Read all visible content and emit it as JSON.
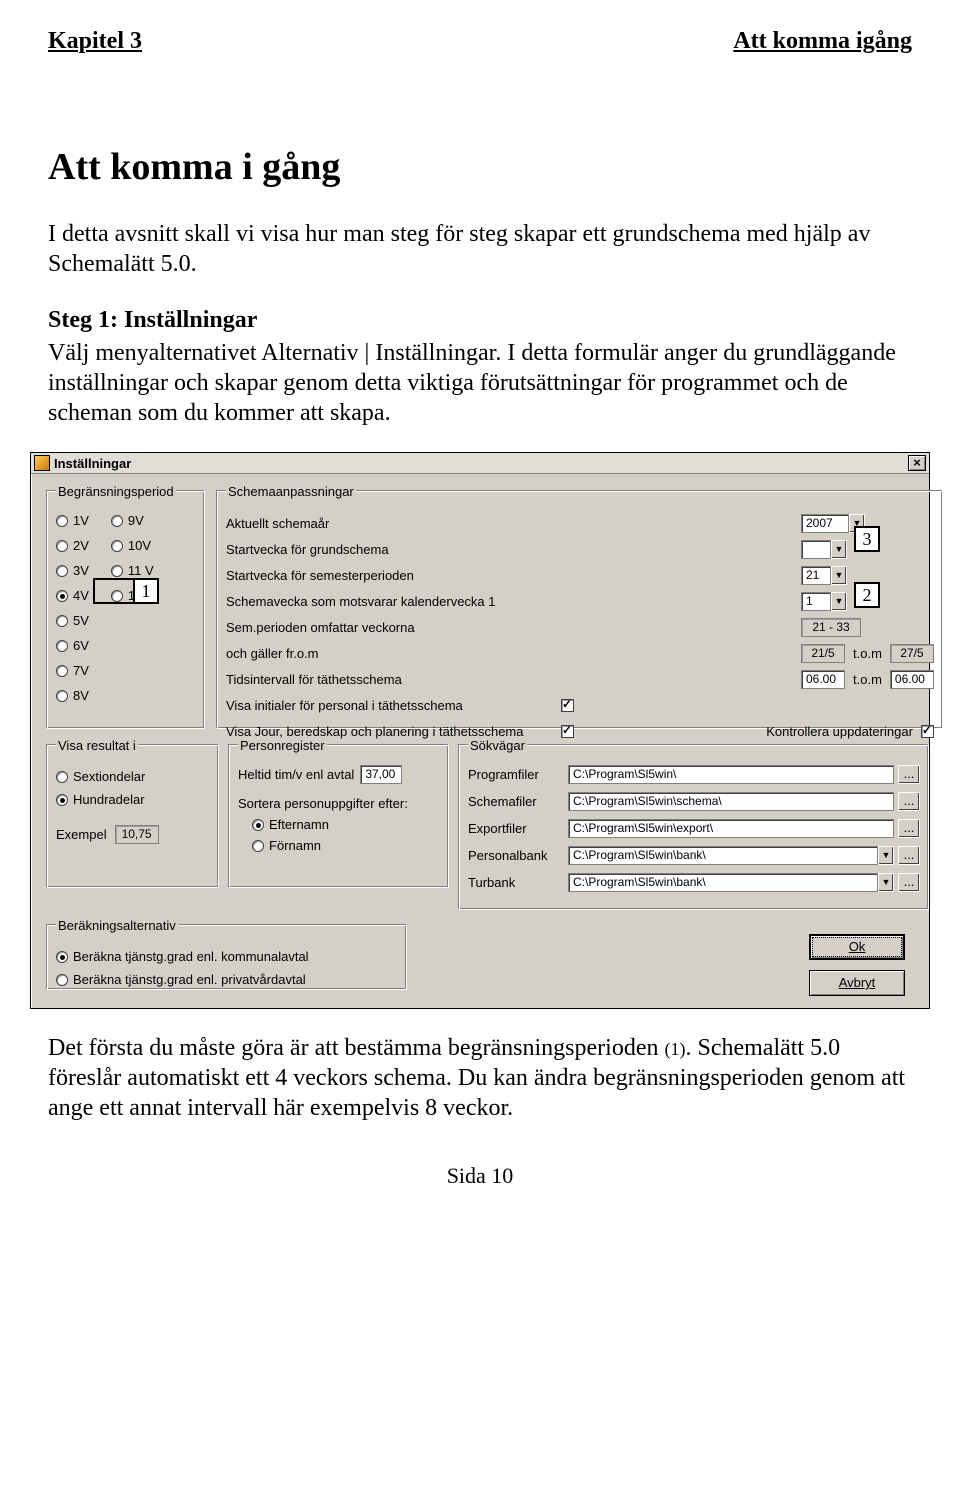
{
  "header": {
    "left": "Kapitel 3",
    "right": "Att komma igång"
  },
  "title": "Att komma i gång",
  "intro": "I detta avsnitt skall vi visa hur man steg för steg skapar ett grundschema med hjälp av Schemalätt 5.0.",
  "step_heading": "Steg 1: Inställningar",
  "step_para": "Välj menyalternativet Alternativ | Inställningar. I detta formulär anger du grundläggande inställningar och skapar genom detta viktiga förutsättningar för programmet och de scheman som du kommer att skapa.",
  "after_para_a": "Det första du måste göra är att bestämma begränsningsperioden ",
  "after_ref": "(1)",
  "after_para_b": ". Schemalätt 5.0 föreslår automatiskt ett 4 veckors schema. Du kan ändra begränsningsperioden genom att ange ett annat intervall här exempelvis 8 veckor.",
  "footer": "Sida 10",
  "callouts": {
    "one": "1",
    "two": "2",
    "three": "3"
  },
  "dlg": {
    "title": "Inställningar",
    "close": "×",
    "groups": {
      "begr": "Begränsningsperiod",
      "schema": "Schemaanpassningar",
      "visa": "Visa resultat i",
      "pers": "Personregister",
      "sok": "Sökvägar",
      "calc": "Beräkningsalternativ"
    },
    "begr_left": [
      "1V",
      "2V",
      "3V",
      "4V",
      "5V",
      "6V",
      "7V",
      "8V"
    ],
    "begr_right": [
      "9V",
      "10V",
      "11 V",
      "12V"
    ],
    "begr_selected": "4V",
    "schema_rows": {
      "aktuellt": "Aktuellt schemaår",
      "start_grund": "Startvecka för grundschema",
      "start_sem": "Startvecka för semesterperioden",
      "schemavecka": "Schemavecka som motsvarar kalendervecka 1",
      "sem_omfattar": "Sem.perioden omfattar veckorna",
      "galler": "och gäller fr.o.m",
      "tidsint": "Tidsintervall för täthetsschema",
      "visa_init": "Visa initialer för personal i täthetsschema",
      "visa_jour": "Visa Jour, beredskap och planering i täthetsschema",
      "kontrollera": "Kontrollera uppdateringar"
    },
    "tom": "t.o.m",
    "vals": {
      "year": "2007",
      "start_grund": "",
      "start_sem": "21",
      "schemavecka": "1",
      "sem_range": "21 - 33",
      "galler_from": "21/5",
      "galler_to": "27/5",
      "tids_from": "06.00",
      "tids_to": "06.00"
    },
    "visa": {
      "sextio": "Sextiondelar",
      "hundra": "Hundradelar",
      "exempel_lbl": "Exempel",
      "exempel_val": "10,75"
    },
    "pers": {
      "heltid_lbl": "Heltid tim/v enl avtal",
      "heltid_val": "37,00",
      "sortera": "Sortera personuppgifter efter:",
      "efternamn": "Efternamn",
      "fornamn": "Förnamn"
    },
    "sok": {
      "program_lbl": "Programfiler",
      "schema_lbl": "Schemafiler",
      "export_lbl": "Exportfiler",
      "pbank_lbl": "Personalbank",
      "tbank_lbl": "Turbank",
      "program": "C:\\Program\\Sl5win\\",
      "schema": "C:\\Program\\Sl5win\\schema\\",
      "export": "C:\\Program\\Sl5win\\export\\",
      "pbank": "C:\\Program\\Sl5win\\bank\\",
      "tbank": "C:\\Program\\Sl5win\\bank\\",
      "ell": "..."
    },
    "calc": {
      "komm": "Beräkna tjänstg.grad enl. kommunalavtal",
      "priv": "Beräkna tjänstg.grad enl. privatvårdavtal"
    },
    "buttons": {
      "ok": "Ok",
      "cancel": "Avbryt"
    }
  }
}
